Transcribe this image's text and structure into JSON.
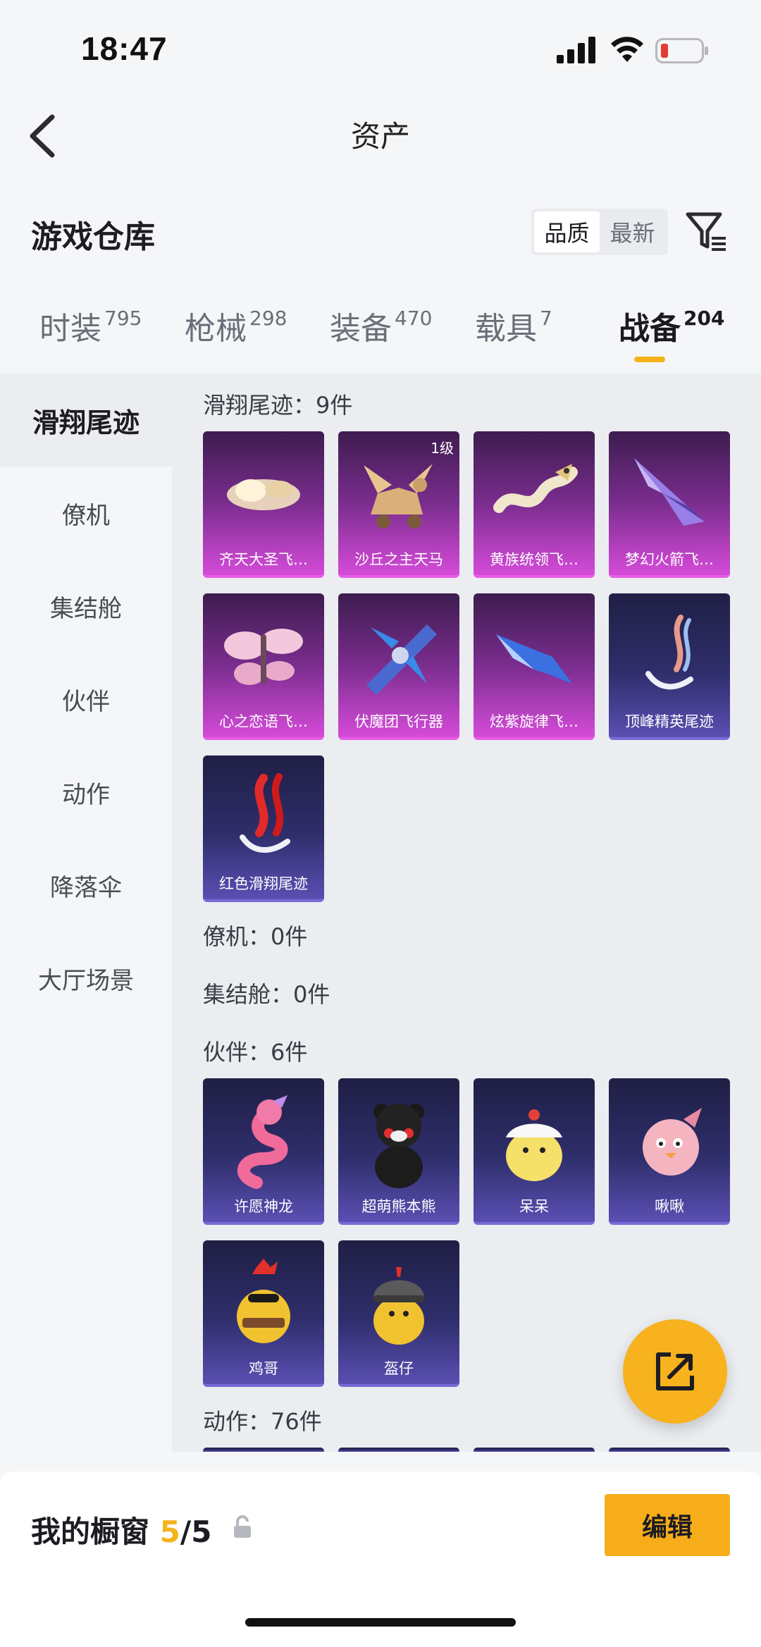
{
  "status_bar": {
    "time": "18:47"
  },
  "nav": {
    "title": "资产"
  },
  "header": {
    "title": "游戏仓库",
    "sort_options": [
      "品质",
      "最新"
    ],
    "sort_active": 0
  },
  "tabs": [
    {
      "label": "时装",
      "count": "795"
    },
    {
      "label": "枪械",
      "count": "298"
    },
    {
      "label": "装备",
      "count": "470"
    },
    {
      "label": "载具",
      "count": "7"
    },
    {
      "label": "战备",
      "count": "204"
    }
  ],
  "active_tab": 4,
  "categories": [
    "滑翔尾迹",
    "僚机",
    "集结舱",
    "伙伴",
    "动作",
    "降落伞",
    "大厅场景"
  ],
  "sections": [
    {
      "header": "滑翔尾迹：9件"
    },
    {
      "header": "僚机：0件"
    },
    {
      "header": "集结舱：0件"
    },
    {
      "header": "伙伴：6件"
    },
    {
      "header": "动作：76件"
    }
  ],
  "glide_items": [
    {
      "name": "齐天大圣飞…",
      "icon": "cloud-icon",
      "rarity": "purple"
    },
    {
      "name": "沙丘之主天马",
      "icon": "pegasus-icon",
      "rarity": "purple",
      "badge": "1级"
    },
    {
      "name": "黄族统领飞…",
      "icon": "dragon-icon",
      "rarity": "purple"
    },
    {
      "name": "梦幻火箭飞…",
      "icon": "glider-icon",
      "rarity": "purple"
    },
    {
      "name": "心之恋语飞…",
      "icon": "butterfly-icon",
      "rarity": "purple"
    },
    {
      "name": "伏魔团飞行器",
      "icon": "aircraft-icon",
      "rarity": "purple"
    },
    {
      "name": "炫紫旋律飞…",
      "icon": "glider-icon",
      "rarity": "purple"
    },
    {
      "name": "顶峰精英尾迹",
      "icon": "trail-icon",
      "rarity": "blue"
    },
    {
      "name": "红色滑翔尾迹",
      "icon": "red-trail-icon",
      "rarity": "blue"
    }
  ],
  "partner_items": [
    {
      "name": "许愿神龙",
      "icon": "pink-dragon-icon",
      "rarity": "blue"
    },
    {
      "name": "超萌熊本熊",
      "icon": "bear-icon",
      "rarity": "blue"
    },
    {
      "name": "呆呆",
      "icon": "chick-icon",
      "rarity": "blue"
    },
    {
      "name": "啾啾",
      "icon": "pink-bird-icon",
      "rarity": "blue"
    },
    {
      "name": "鸡哥",
      "icon": "rooster-icon",
      "rarity": "blue"
    },
    {
      "name": "盔仔",
      "icon": "helmet-chick-icon",
      "rarity": "blue"
    }
  ],
  "showcase": {
    "label": "我的橱窗",
    "used": "5",
    "total": "/5"
  },
  "edit_label": "编辑",
  "colors": {
    "accent": "#f5b31a",
    "purple_card": "#7a2d8e",
    "blue_card": "#2f2e6b"
  }
}
